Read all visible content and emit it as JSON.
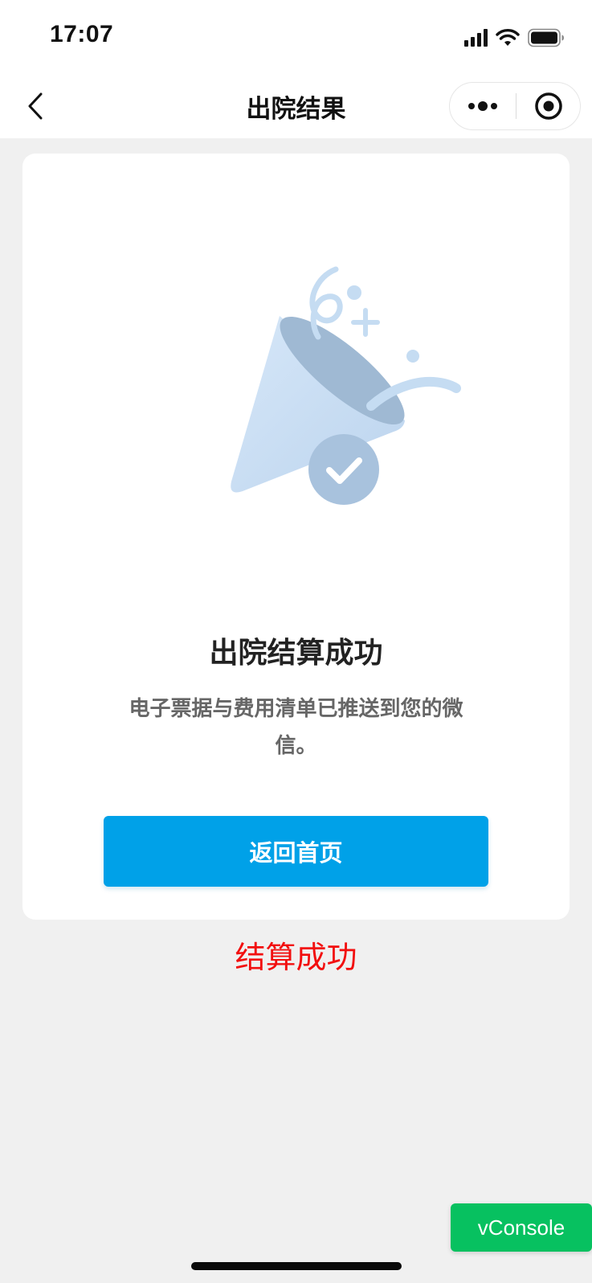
{
  "status_bar": {
    "time": "17:07",
    "icons": [
      "signal-icon",
      "wifi-icon",
      "battery-icon"
    ]
  },
  "nav": {
    "title": "出院结果",
    "back_icon": "chevron-left-icon",
    "more_icon": "more-dots-icon",
    "close_icon": "target-close-icon"
  },
  "result": {
    "illustration": "party-popper-success-icon",
    "title": "出院结算成功",
    "description": "电子票据与费用清单已推送到您的微信。",
    "button_label": "返回首页"
  },
  "note": {
    "text": "结算成功",
    "color": "#f20f0f"
  },
  "vconsole": {
    "label": "vConsole",
    "color": "#07c160"
  },
  "colors": {
    "accent": "#00a1e8",
    "background": "#f0f0f0",
    "illustration_light": "#cde2f7",
    "illustration_dark": "#9fb9d3"
  }
}
